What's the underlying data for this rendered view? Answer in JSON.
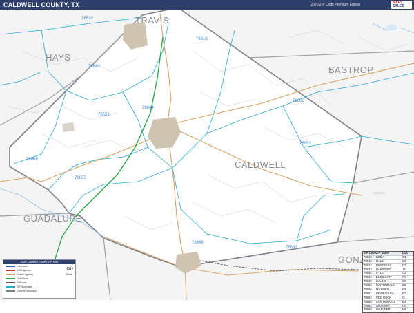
{
  "header": {
    "title": "CALDWELL COUNTY, TX",
    "edition": "2020 ZIP Code Premium Edition",
    "logo_line1": "MAPS",
    "logo_line2": "SALES"
  },
  "map": {
    "county_labels": [
      "TRAVIS",
      "HAYS",
      "BASTROP",
      "CALDWELL",
      "GUADALUPE",
      "GONZ"
    ],
    "zip_labels": [
      "78610",
      "78616",
      "78640",
      "78662",
      "78656",
      "78644",
      "78953",
      "78666",
      "78655",
      "78648",
      "78632"
    ],
    "place_labels": [
      "FAYETTE"
    ],
    "colors": {
      "county_border": "#7d8089",
      "zip_boundary": "#2aa8d4",
      "highway": "#d9a264",
      "rail_green": "#2ea84a",
      "urban": "#cfc4b2",
      "water": "#8cc4ea"
    }
  },
  "legend": {
    "title": "2020 Caldwell County ZIP Map",
    "rows": [
      {
        "label": "Interstate",
        "color": "#3a5ea9"
      },
      {
        "label": "US Highway",
        "color": "#cc3333"
      },
      {
        "label": "State Highway",
        "color": "#d9a264"
      },
      {
        "label": "Toll Road",
        "color": "#2ea84a"
      },
      {
        "label": "Railroad",
        "color": "#555555"
      },
      {
        "label": "ZIP Boundary",
        "color": "#2aa8d4"
      },
      {
        "label": "County Boundary",
        "color": "#7d8089"
      }
    ],
    "city_label": "City",
    "state_label": "State"
  },
  "zip_table": {
    "headers": [
      "ZIP Code",
      "ZIP Name",
      "LOC"
    ],
    "rows": [
      [
        "78610",
        "BUDA",
        "C1"
      ],
      [
        "78616",
        "DALE",
        "D2"
      ],
      [
        "78622",
        "FENTRESS",
        "D7"
      ],
      [
        "78632",
        "HARWOOD",
        "J8"
      ],
      [
        "78640",
        "KYLE",
        "C2"
      ],
      [
        "78644",
        "LOCKHART",
        "F4"
      ],
      [
        "78648",
        "LULING",
        "G8"
      ],
      [
        "78655",
        "MARTINDALE",
        "E8"
      ],
      [
        "78656",
        "MAXWELL",
        "D4"
      ],
      [
        "78661",
        "PRAIRIE LEA",
        "E7"
      ],
      [
        "78662",
        "RED ROCK",
        "I3"
      ],
      [
        "78666",
        "SAN MARCOS",
        "B4"
      ],
      [
        "78953",
        "ROSANKY",
        "L6"
      ],
      [
        "78959",
        "WAELDER",
        "M9"
      ]
    ]
  }
}
